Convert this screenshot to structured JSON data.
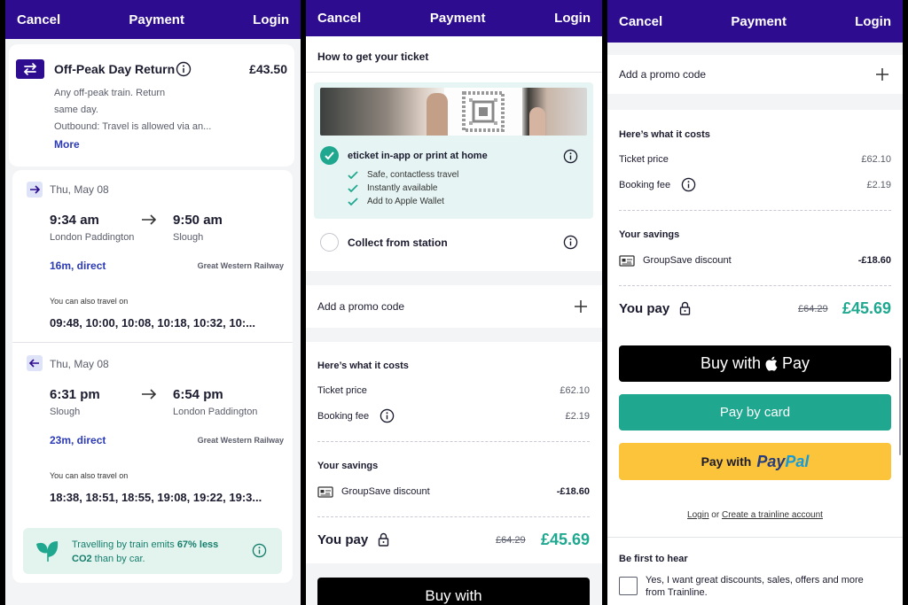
{
  "nav": {
    "cancel": "Cancel",
    "title": "Payment",
    "login": "Login"
  },
  "ticket": {
    "name": "Off-Peak Day Return",
    "price": "£43.50",
    "desc_line1": "Any off-peak train. Return",
    "desc_line2": "same day.",
    "desc_line3": "Outbound: Travel is allowed via an...",
    "more": "More"
  },
  "outbound": {
    "date": "Thu, May 08",
    "depart_time": "9:34 am",
    "depart_station": "London Paddington",
    "arrive_time": "9:50 am",
    "arrive_station": "Slough",
    "duration": "16m, direct",
    "operator": "Great Western Railway",
    "also_label": "You can also travel on",
    "also_times": "09:48, 10:00, 10:08, 10:18, 10:32, 10:..."
  },
  "return": {
    "date": "Thu, May 08",
    "depart_time": "6:31 pm",
    "depart_station": "Slough",
    "arrive_time": "6:54 pm",
    "arrive_station": "London Paddington",
    "duration": "23m, direct",
    "operator": "Great Western Railway",
    "also_label": "You can also travel on",
    "also_times": "18:38, 18:51, 18:55, 19:08, 19:22, 19:3..."
  },
  "co2": {
    "text_a": "Travelling by train emits ",
    "text_bold": "67% less",
    "text_b": "CO2",
    "text_c": " than by car."
  },
  "delivery": {
    "heading": "How to get your ticket",
    "option1": "eticket in-app or print at home",
    "benefits": [
      "Safe, contactless travel",
      "Instantly available",
      "Add to Apple Wallet"
    ],
    "option2": "Collect from station"
  },
  "promo": {
    "label": "Add a promo code"
  },
  "costs": {
    "heading": "Here’s what it costs",
    "ticket_price_label": "Ticket price",
    "ticket_price": "£62.10",
    "booking_fee_label": "Booking fee",
    "booking_fee": "£2.19",
    "savings_heading": "Your savings",
    "discount_label": "GroupSave discount",
    "discount": "-£18.60",
    "you_pay_label": "You pay",
    "old_total": "£64.29",
    "total": "£45.69"
  },
  "buttons": {
    "apple_buy": "Buy with",
    "apple_pay": "Pay",
    "card": "Pay by card",
    "paypal_prefix": "Pay with",
    "paypal_pay": "Pay",
    "paypal_pal": "Pal"
  },
  "account": {
    "login": "Login",
    "or": " or ",
    "create": "Create a trainline account"
  },
  "newsletter": {
    "heading": "Be first to hear",
    "text1": "Yes, I want great discounts, sales, offers and more",
    "text2": "from Trainline."
  },
  "colors": {
    "nav": "#2d0c8f",
    "teal": "#1fa88f",
    "apple": "#000000",
    "paypal": "#fbc43a",
    "link": "#2b3ab6"
  }
}
